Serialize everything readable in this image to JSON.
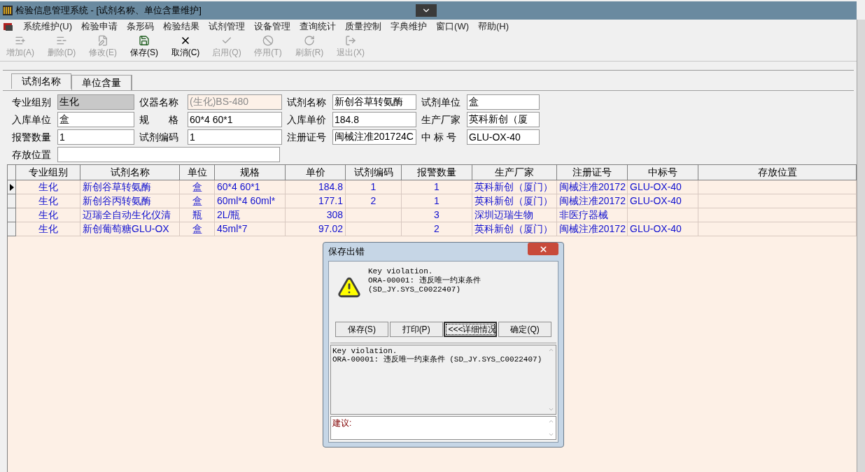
{
  "window": {
    "title": "检验信息管理系统 - [试剂名称、单位含量维护]"
  },
  "menu": [
    "系统维护(U)",
    "检验申请",
    "条形码",
    "检验结果",
    "试剂管理",
    "设备管理",
    "查询统计",
    "质量控制",
    "字典维护",
    "窗口(W)",
    "帮助(H)"
  ],
  "toolbar": [
    {
      "kind": "add",
      "label": "增加(A)",
      "disabled": true
    },
    {
      "kind": "delete",
      "label": "删除(D)",
      "disabled": true
    },
    {
      "kind": "edit",
      "label": "修改(E)",
      "disabled": true
    },
    {
      "kind": "save",
      "label": "保存(S)",
      "disabled": false
    },
    {
      "kind": "cancel",
      "label": "取消(C)",
      "disabled": false
    },
    {
      "kind": "enable",
      "label": "启用(Q)",
      "disabled": true
    },
    {
      "kind": "disable",
      "label": "停用(T)",
      "disabled": true
    },
    {
      "kind": "refresh",
      "label": "刷新(R)",
      "disabled": true
    },
    {
      "kind": "exit",
      "label": "退出(X)",
      "disabled": true
    }
  ],
  "tabs": [
    {
      "label": "试剂名称",
      "selected": true
    },
    {
      "label": "单位含量",
      "selected": false
    }
  ],
  "form": [
    {
      "label": "专业组别",
      "value": "生化",
      "disabled": false,
      "readonly": true
    },
    {
      "label": "仪器名称",
      "value": "(生化)BS-480",
      "disabled": true,
      "readonly": false
    },
    {
      "label": "试剂名称",
      "value": "新创谷草转氨酶",
      "disabled": false,
      "readonly": false
    },
    {
      "label": "试剂单位",
      "value": "盒",
      "disabled": false,
      "readonly": false
    },
    {
      "label": "入库单位",
      "value": "盒",
      "disabled": false,
      "readonly": false
    },
    {
      "label": "规　　格",
      "value": "60*4 60*1",
      "disabled": false,
      "readonly": false
    },
    {
      "label": "入库单价",
      "value": "184.8",
      "disabled": false,
      "readonly": false
    },
    {
      "label": "生产厂家",
      "value": "英科新创（厦",
      "disabled": false,
      "readonly": false
    },
    {
      "label": "报警数量",
      "value": "1",
      "disabled": false,
      "readonly": false
    },
    {
      "label": "试剂编码",
      "value": "1",
      "disabled": false,
      "readonly": false
    },
    {
      "label": "注册证号",
      "value": "闽械注准201724C",
      "disabled": false,
      "readonly": false
    },
    {
      "label": "中 标 号",
      "value": "GLU-OX-40",
      "disabled": false,
      "readonly": false
    },
    {
      "label": "存放位置",
      "disabled": false,
      "readonly": false
    }
  ],
  "table": {
    "columns": [
      "专业组别",
      "试剂名称",
      "单位",
      "规格",
      "单价",
      "试剂编码",
      "报警数量",
      "生产厂家",
      "注册证号",
      "中标号",
      "存放位置"
    ],
    "rows": [
      {
        "selected": true,
        "cells": [
          "生化",
          "新创谷草转氨酶",
          "盒",
          "60*4 60*1",
          "184.8",
          "1",
          "1",
          "英科新创（厦门）",
          "闽械注准20172",
          "GLU-OX-40",
          ""
        ]
      },
      {
        "selected": false,
        "cells": [
          "生化",
          "新创谷丙转氨酶",
          "盒",
          "60ml*4 60ml*",
          "177.1",
          "2",
          "1",
          "英科新创（厦门）",
          "闽械注准20172",
          "GLU-OX-40",
          ""
        ]
      },
      {
        "selected": false,
        "cells": [
          "生化",
          "迈瑞全自动生化仪清",
          "瓶",
          "2L/瓶",
          "308",
          "",
          "3",
          "深圳迈瑞生物",
          "非医疗器械",
          "",
          ""
        ]
      },
      {
        "selected": false,
        "cells": [
          "生化",
          "新创葡萄糖GLU-OX",
          "盒",
          "45ml*7",
          "97.02",
          "",
          "2",
          "英科新创（厦门）",
          "闽械注准20172",
          "GLU-OX-40",
          ""
        ]
      }
    ]
  },
  "dialog": {
    "title": "保存出错",
    "message": [
      "Key violation.",
      "ORA-00001: 违反唯一约束条件",
      "(SD_JY.SYS_C0022407)"
    ],
    "buttons": [
      {
        "label": "保存(S)",
        "focused": false
      },
      {
        "label": "打印(P)",
        "focused": false
      },
      {
        "label": "<<<详细情况",
        "focused": true
      },
      {
        "label": "确定(Q)",
        "focused": false
      }
    ],
    "details": [
      "Key violation.",
      "ORA-00001: 违反唯一约束条件 (SD_JY.SYS_C0022407)"
    ],
    "suggestion_label": "建议:"
  }
}
